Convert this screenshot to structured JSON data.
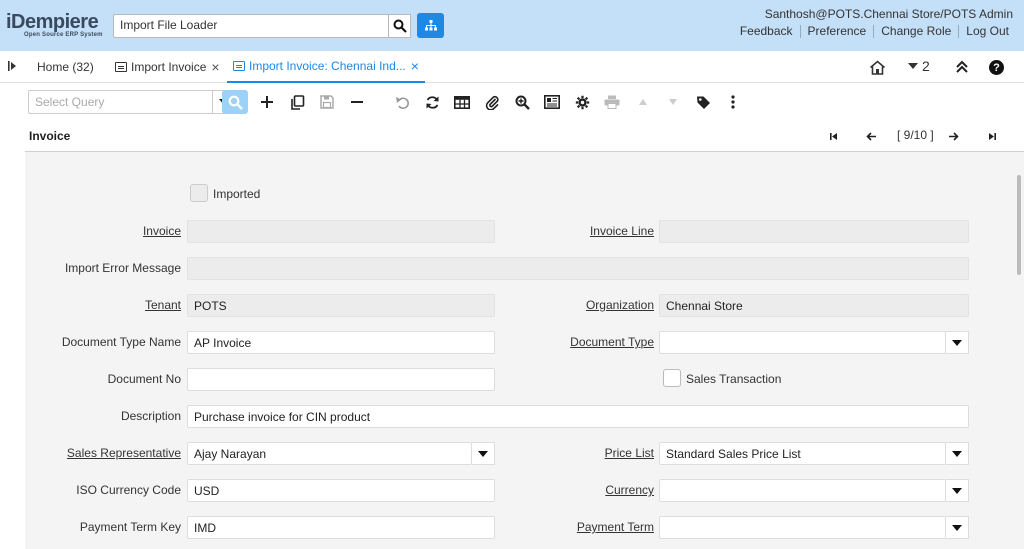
{
  "header": {
    "logo_text": "iDempiere",
    "logo_subtext": "Open Source ERP System",
    "menu_search_value": "Import File Loader",
    "user_info": "Santhosh@POTS.Chennai Store/POTS Admin",
    "links": [
      "Feedback",
      "Preference",
      "Change Role",
      "Log Out"
    ]
  },
  "tabs": [
    {
      "label": "Home (32)",
      "closable": false
    },
    {
      "label": "Import Invoice",
      "closable": true
    },
    {
      "label": "Import Invoice: Chennai Ind...",
      "closable": true,
      "selected": true
    }
  ],
  "tab_close_glyph": "×",
  "window_tools": {
    "count_label": "2"
  },
  "toolbar": {
    "query_placeholder": "Select Query",
    "buttons": [
      "search-icon",
      "new-icon",
      "copy-icon",
      "save-icon",
      "delete-icon",
      "undo-icon",
      "refresh-icon",
      "grid-toggle-icon",
      "attachment-icon",
      "zoom-icon",
      "report-icon",
      "process-icon",
      "print-icon",
      "previous-icon",
      "next-icon",
      "tag-icon",
      "more-icon"
    ]
  },
  "title_row": {
    "title": "Invoice",
    "record_info": "[ 9/10 ]"
  },
  "form": {
    "imported_label": "Imported",
    "invoice_label": "Invoice",
    "invoice_value": "",
    "invoice_line_label": "Invoice Line",
    "invoice_line_value": "",
    "import_error_label": "Import Error Message",
    "import_error_value": "",
    "tenant_label": "Tenant",
    "tenant_value": "POTS",
    "organization_label": "Organization",
    "organization_value": "Chennai Store",
    "doc_type_name_label": "Document Type Name",
    "doc_type_name_value": "AP Invoice",
    "doc_type_label": "Document Type",
    "doc_type_value": "",
    "doc_no_label": "Document No",
    "doc_no_value": "",
    "sales_transaction_label": "Sales Transaction",
    "description_label": "Description",
    "description_value": "Purchase invoice for CIN product",
    "sales_rep_label": "Sales Representative",
    "sales_rep_value": "Ajay Narayan",
    "price_list_label": "Price List",
    "price_list_value": "Standard Sales Price List",
    "iso_currency_label": "ISO Currency Code",
    "iso_currency_value": "USD",
    "currency_label": "Currency",
    "currency_value": "",
    "payment_term_key_label": "Payment Term Key",
    "payment_term_key_value": "IMD",
    "payment_term_label": "Payment Term",
    "payment_term_value": ""
  },
  "colors": {
    "header_bg": "#c4e0f8",
    "accent": "#1e88e5",
    "form_bg": "#f4f4f4"
  }
}
